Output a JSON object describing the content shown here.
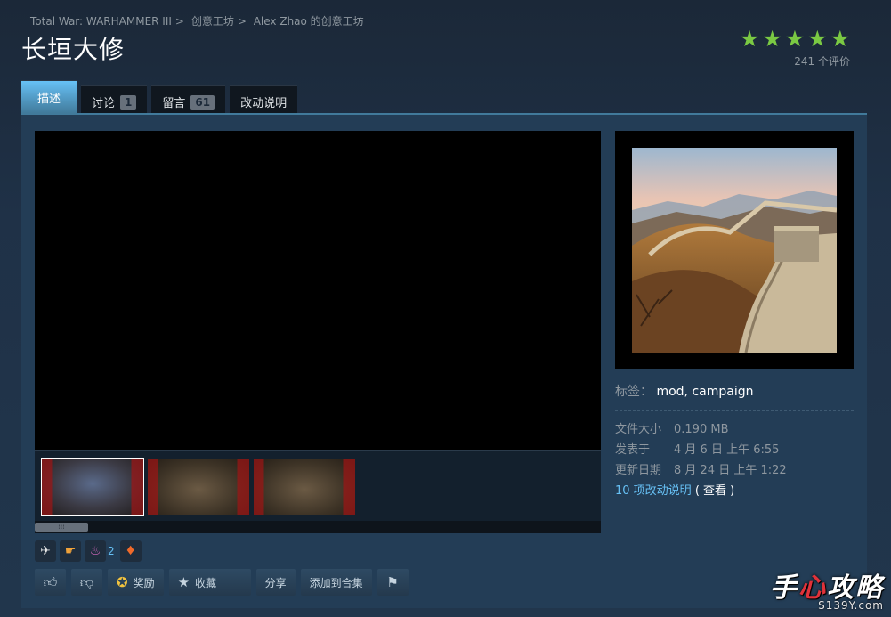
{
  "breadcrumb": [
    "Total War: WARHAMMER III",
    "创意工坊",
    "Alex Zhao 的创意工坊"
  ],
  "title": "长垣大修",
  "rating": {
    "stars": 5,
    "count_label": "241 个评价",
    "star_color": "#7ac943"
  },
  "tabs": [
    {
      "label": "描述",
      "active": true
    },
    {
      "label": "讨论",
      "badge": "1"
    },
    {
      "label": "留言",
      "badge": "61"
    },
    {
      "label": "改动说明"
    }
  ],
  "media": {
    "thumbnails": 3,
    "active_thumbnail": 0
  },
  "tags": {
    "label": "标签：",
    "value": "mod, campaign"
  },
  "details": [
    {
      "key": "文件大小",
      "value": "0.190 MB"
    },
    {
      "key": "发表于",
      "value": "4 月 6 日 上午 6:55"
    },
    {
      "key": "更新日期",
      "value": "8 月 24 日 上午 1:22"
    }
  ],
  "changelog": {
    "link": "10 项改动说明",
    "view": "( 查看 )"
  },
  "awards": {
    "count_label": "2"
  },
  "actions": {
    "award": "奖励",
    "favorite": "收藏",
    "share": "分享",
    "add_collection": "添加到合集"
  },
  "watermark": {
    "main_a": "手",
    "main_b": "心",
    "main_c": "攻略",
    "sub": "S139Y.com"
  },
  "colors": {
    "accent": "#67c1f5",
    "background": "#1b2838"
  }
}
